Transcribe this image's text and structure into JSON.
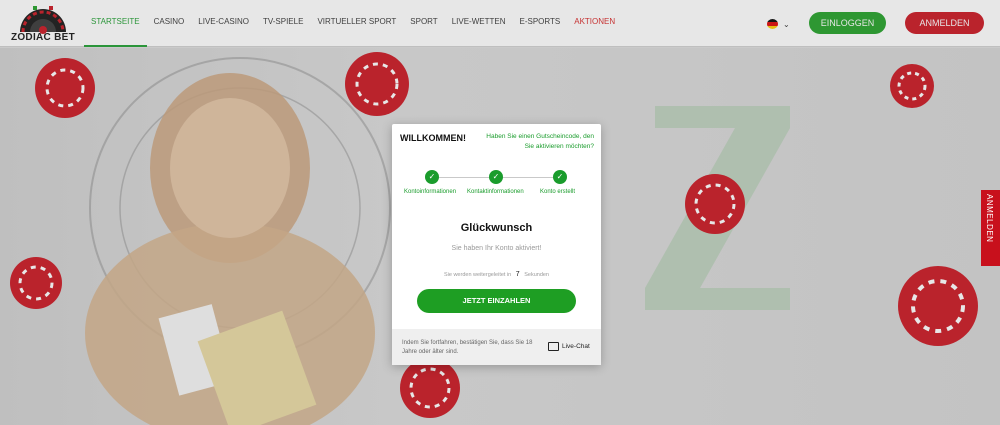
{
  "header": {
    "logo_text": "ZODIAC BET",
    "nav": [
      {
        "label": "STARTSEITE",
        "state": "active"
      },
      {
        "label": "CASINO"
      },
      {
        "label": "LIVE-CASINO"
      },
      {
        "label": "TV-SPIELE"
      },
      {
        "label": "VIRTUELLER SPORT"
      },
      {
        "label": "SPORT"
      },
      {
        "label": "LIVE-WETTEN"
      },
      {
        "label": "E-SPORTS"
      },
      {
        "label": "AKTIONEN",
        "state": "promo"
      }
    ],
    "language_icon": "german-flag-icon",
    "login_label": "EINLOGGEN",
    "register_label": "ANMELDEN"
  },
  "side_tab": {
    "label": "ANMELDEN",
    "icon": "grid-icon"
  },
  "modal": {
    "title": "WILLKOMMEN!",
    "voucher_text": "Haben Sie einen Gutscheincode, den Sie aktivieren möchten?",
    "steps": [
      {
        "label": "Kontoinformationen",
        "done": true
      },
      {
        "label": "Kontaktinformationen",
        "done": true
      },
      {
        "label": "Konto erstellt",
        "done": true
      }
    ],
    "heading": "Glückwunsch",
    "activated_text": "Sie haben Ihr Konto aktiviert!",
    "redirect_prefix": "Sie werden weitergeleitet in",
    "redirect_seconds": "7",
    "redirect_suffix": "Sekunden",
    "deposit_label": "JETZT EINZAHLEN",
    "consent_text": "Indem Sie fortfahren, bestätigen Sie, dass Sie 18 Jahre oder älter sind.",
    "chat_label": "Live-Chat"
  },
  "colors": {
    "green": "#1e9e23",
    "red": "#c8101c",
    "accent_text": "#1a9c2c"
  }
}
